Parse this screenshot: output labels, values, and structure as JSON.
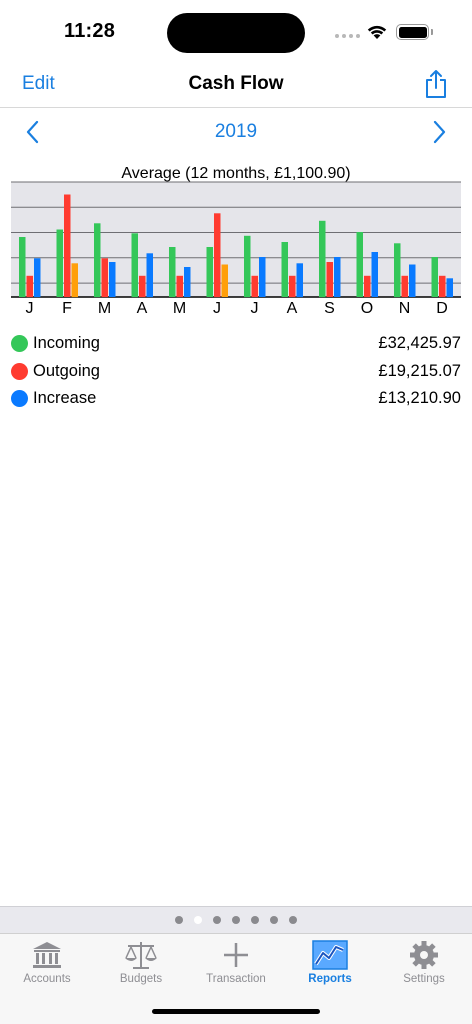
{
  "status": {
    "time": "11:28"
  },
  "nav": {
    "edit_label": "Edit",
    "title": "Cash Flow"
  },
  "year": {
    "label": "2019"
  },
  "colors": {
    "incoming": "#34c759",
    "outgoing": "#ff3b30",
    "increase": "#0a7aff",
    "positive_increase": "#ff9f0a",
    "accent": "#1a7fe0"
  },
  "chart_data": {
    "type": "bar",
    "title": "Average (12 months, £1,100.90)",
    "categories": [
      "J",
      "F",
      "M",
      "A",
      "M",
      "J",
      "J",
      "A",
      "S",
      "O",
      "N",
      "D"
    ],
    "series": [
      {
        "name": "Incoming",
        "values": [
          2400,
          2700,
          2950,
          2550,
          2000,
          2000,
          2450,
          2200,
          3050,
          2600,
          2150,
          1600
        ]
      },
      {
        "name": "Outgoing",
        "values": [
          850,
          4100,
          1550,
          850,
          850,
          3350,
          850,
          850,
          1400,
          850,
          850,
          850
        ]
      },
      {
        "name": "Increase",
        "values": [
          1550,
          1350,
          1400,
          1750,
          1200,
          1300,
          1600,
          1350,
          1600,
          1800,
          1300,
          750
        ]
      }
    ],
    "increase_orange": [
      false,
      true,
      false,
      false,
      false,
      true,
      false,
      false,
      false,
      false,
      false,
      false
    ],
    "ylim": [
      0,
      4600
    ],
    "grid": true
  },
  "legend": [
    {
      "label": "Incoming",
      "value": "£32,425.97",
      "color": "#34c759"
    },
    {
      "label": "Outgoing",
      "value": "£19,215.07",
      "color": "#ff3b30"
    },
    {
      "label": "Increase",
      "value": "£13,210.90",
      "color": "#0a7aff"
    }
  ],
  "pager": {
    "count": 7,
    "active_index": 1
  },
  "tabs": [
    {
      "label": "Accounts",
      "icon": "bank-icon"
    },
    {
      "label": "Budgets",
      "icon": "scales-icon"
    },
    {
      "label": "Transaction",
      "icon": "plus-icon"
    },
    {
      "label": "Reports",
      "icon": "chart-icon",
      "active": true
    },
    {
      "label": "Settings",
      "icon": "gear-icon"
    }
  ]
}
